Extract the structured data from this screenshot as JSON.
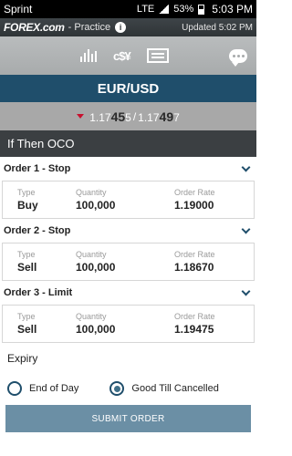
{
  "status_bar": {
    "carrier": "Sprint",
    "battery": "53%",
    "time": "5:03 PM",
    "network": "LTE"
  },
  "brand_bar": {
    "brand": "FOREX.com",
    "mode": "- Practice",
    "updated": "Updated 5:02 PM"
  },
  "pair": "EUR/USD",
  "quote": {
    "bid_prefix": "1.17",
    "bid_big": "45",
    "bid_pip": "5",
    "ask_prefix": "1.17",
    "ask_big": "49",
    "ask_pip": "7",
    "direction": "down"
  },
  "section_title": "If Then OCO",
  "orders": [
    {
      "title": "Order 1 - Stop",
      "type": "Buy",
      "quantity": "100,000",
      "rate": "1.19000"
    },
    {
      "title": "Order 2 - Stop",
      "type": "Sell",
      "quantity": "100,000",
      "rate": "1.18670"
    },
    {
      "title": "Order 3 - Limit",
      "type": "Sell",
      "quantity": "100,000",
      "rate": "1.19475"
    }
  ],
  "labels": {
    "type": "Type",
    "quantity": "Quantity",
    "rate": "Order Rate"
  },
  "expiry": {
    "label": "Expiry",
    "options": [
      "End of Day",
      "Good Till Cancelled"
    ],
    "selected": "Good Till Cancelled"
  },
  "submit_label": "SUBMIT ORDER",
  "colors": {
    "primary": "#1f4e6b",
    "down": "#c8102e",
    "submit": "#6b8fa5"
  }
}
